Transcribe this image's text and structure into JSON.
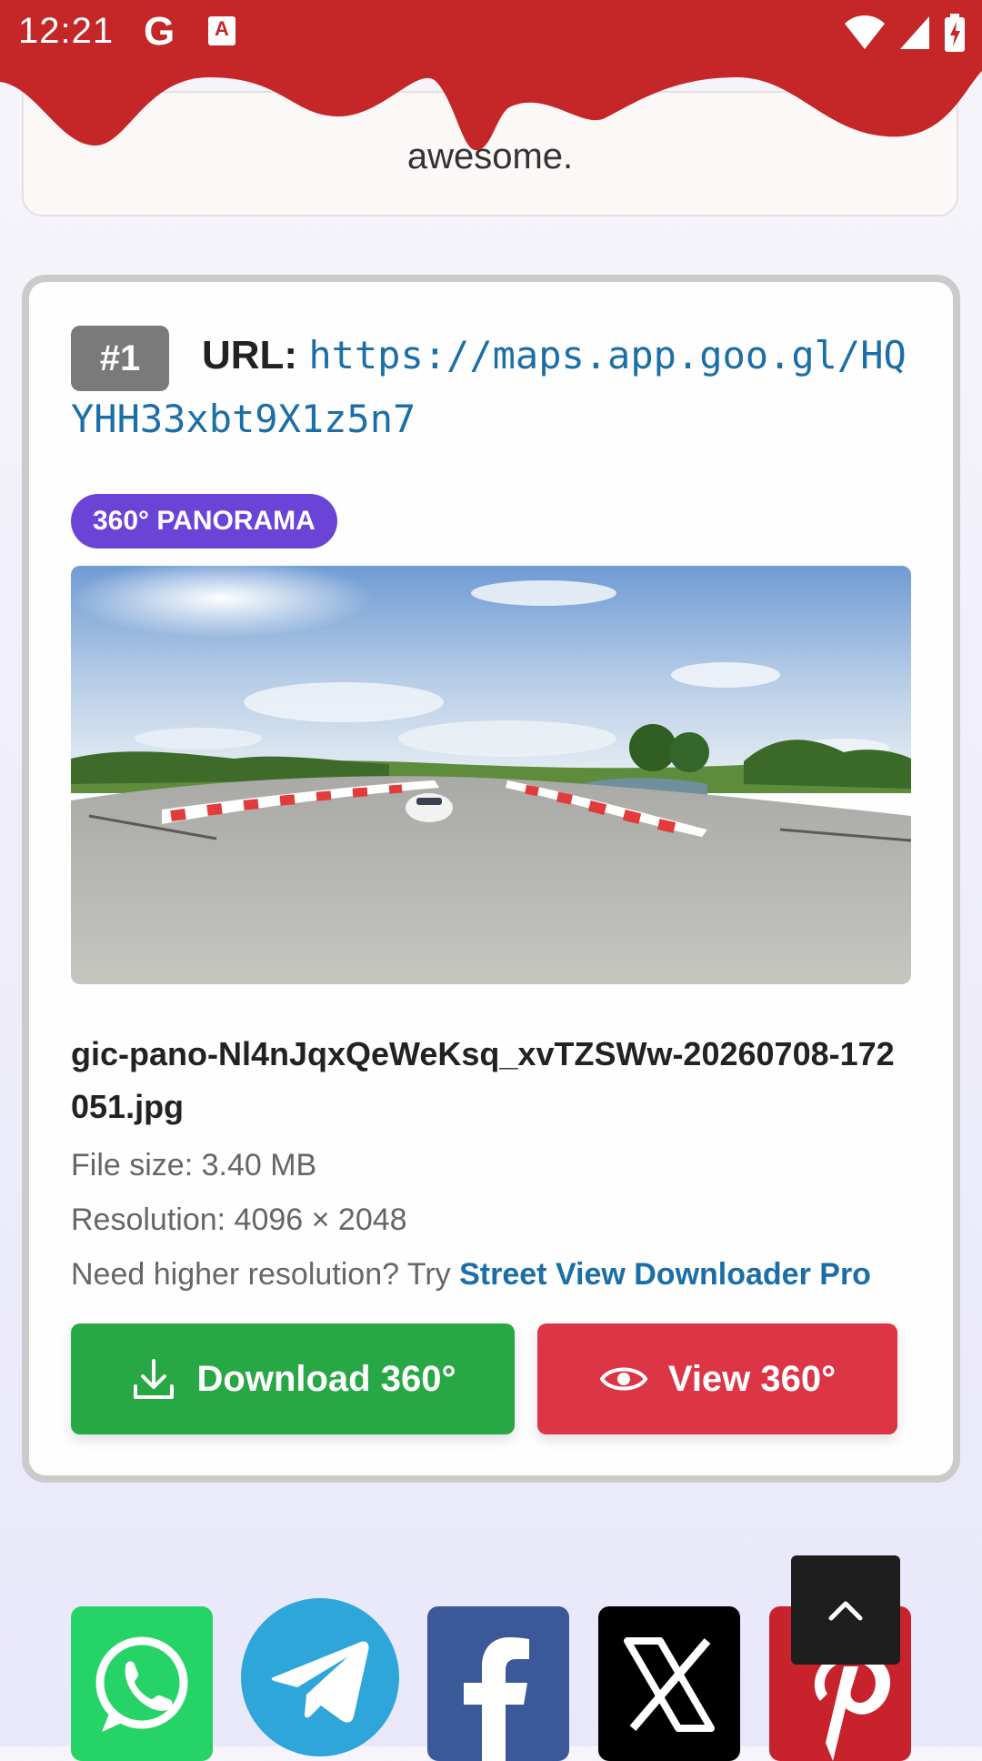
{
  "status_bar": {
    "time": "12:21",
    "icons": [
      "google-icon",
      "app-a-icon",
      "wifi-icon",
      "signal-icon",
      "battery-charging-icon"
    ],
    "app_letter": "A"
  },
  "header": {
    "color": "#c52628"
  },
  "previous_card": {
    "text_tail": "awesome."
  },
  "result": {
    "number": "#1",
    "url_label": "URL:",
    "url": "https://maps.app.goo.gl/HQYHH33xbt9X1z5n7",
    "type_badge": "360° PANORAMA",
    "file_name": "gic-pano-Nl4nJqxQeWeKsq_xvTZSWw-20260708-172051.jpg",
    "file_size": "File size: 3.40 MB",
    "resolution": "Resolution: 4096 × 2048",
    "pro_prompt": "Need higher resolution? Try ",
    "pro_link": "Street View Downloader Pro",
    "download_label": "Download 360°",
    "view_label": "View 360°"
  },
  "share": {
    "icons": [
      "whatsapp-icon",
      "telegram-icon",
      "facebook-icon",
      "x-icon",
      "pinterest-icon"
    ]
  },
  "colors": {
    "accent_purple": "#6a43d7",
    "download_green": "#28a745",
    "view_red": "#dc3545",
    "link_blue": "#1c6fa6"
  }
}
